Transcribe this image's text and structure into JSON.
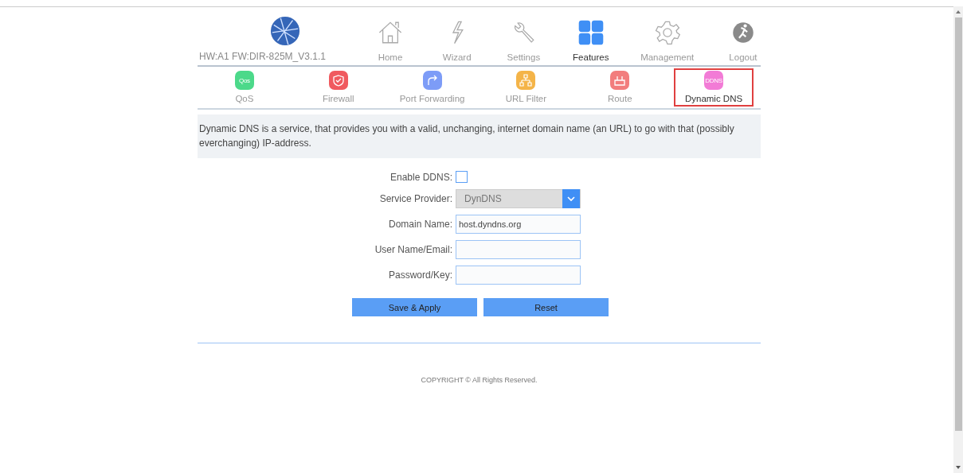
{
  "header": {
    "version": "HW:A1 FW:DIR-825M_V3.1.1"
  },
  "nav": [
    {
      "label": "Home",
      "kind": "home",
      "selected": false
    },
    {
      "label": "Wizard",
      "kind": "wizard",
      "selected": false
    },
    {
      "label": "Settings",
      "kind": "settings",
      "selected": false
    },
    {
      "label": "Features",
      "kind": "features",
      "selected": true
    },
    {
      "label": "Management",
      "kind": "management",
      "selected": false
    },
    {
      "label": "Logout",
      "kind": "logout",
      "selected": false
    }
  ],
  "subnav": [
    {
      "label": "QoS",
      "kind": "qos",
      "icon_text": "Qos",
      "color": "#4cd98a",
      "selected": false
    },
    {
      "label": "Firewall",
      "kind": "firewall",
      "color": "#f05a5f",
      "selected": false
    },
    {
      "label": "Port Forwarding",
      "kind": "forward",
      "color": "#7d9cf7",
      "selected": false
    },
    {
      "label": "URL Filter",
      "kind": "url",
      "color": "#f4b448",
      "selected": false
    },
    {
      "label": "Route",
      "kind": "route",
      "color": "#f27d7d",
      "selected": false
    },
    {
      "label": "Dynamic DNS",
      "kind": "ddns",
      "icon_text": "DDNS",
      "color": "#f27bd6",
      "selected": true
    }
  ],
  "description": "Dynamic DNS is a service, that provides you with a valid, unchanging, internet domain name (an URL) to go with that (possibly everchanging) IP-address.",
  "form": [
    {
      "label": "Enable DDNS:",
      "kind": "checkbox",
      "checked": false
    },
    {
      "label": "Service Provider:",
      "kind": "select",
      "value": "DynDNS"
    },
    {
      "label": "Domain Name:",
      "kind": "text",
      "value": "host.dyndns.org"
    },
    {
      "label": "User Name/Email:",
      "kind": "text"
    },
    {
      "label": "Password/Key:",
      "kind": "text"
    }
  ],
  "buttons": [
    "Save & Apply",
    "Reset"
  ],
  "footer": "COPYRIGHT © All Rights Reserved."
}
